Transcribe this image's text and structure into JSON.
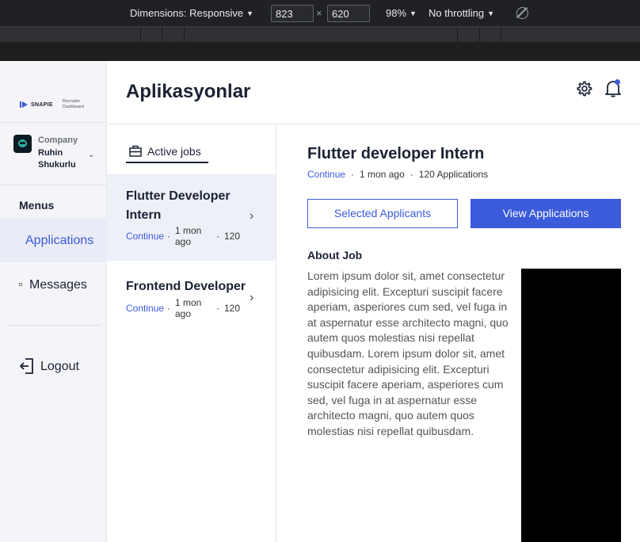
{
  "devtools": {
    "dimensions_label": "Dimensions: Responsive",
    "width": "823",
    "height": "620",
    "times": "×",
    "zoom": "98%",
    "throttling": "No throttling"
  },
  "sidebar": {
    "logo_text": "SNAPIE",
    "logo_sub": "Recruiter Dashboard",
    "company_label": "Company",
    "company_name": "Ruhin Shukurlu",
    "menus_title": "Menus",
    "items": [
      {
        "label": "Applications",
        "active": true
      },
      {
        "label": "Messages",
        "active": false
      }
    ],
    "logout_label": "Logout"
  },
  "header": {
    "title": "Aplikasyonlar",
    "icons": [
      "gear-icon",
      "bell-icon"
    ],
    "notification": true
  },
  "jobs": {
    "tab_label": "Active jobs",
    "items": [
      {
        "title": "Flutter Developer Intern",
        "status": "Continue",
        "time": "1 mon ago",
        "count": "120",
        "selected": true
      },
      {
        "title": "Frontend Developer",
        "status": "Continue",
        "time": "1 mon ago",
        "count": "120",
        "selected": false
      }
    ]
  },
  "detail": {
    "title": "Flutter developer Intern",
    "status": "Continue",
    "time": "1 mon ago",
    "applications": "120 Applications",
    "selected_button": "Selected Applicants",
    "view_button": "View Applications",
    "about_title": "About Job",
    "about_text": "Lorem ipsum dolor sit, amet consectetur adipisicing elit. Excepturi suscipit facere aperiam, asperiores cum sed, vel fuga in at aspernatur esse architecto magni, quo autem quos molestias nisi repellat quibusdam. Lorem ipsum dolor sit, amet consectetur adipisicing elit. Excepturi suscipit facere aperiam, asperiores cum sed, vel fuga in at aspernatur esse architecto magni, quo autem quos molestias nisi repellat quibusdam."
  },
  "colors": {
    "accent": "#3b5bdb",
    "text": "#1a2233",
    "sidebar_bg": "#f5f5f9"
  }
}
